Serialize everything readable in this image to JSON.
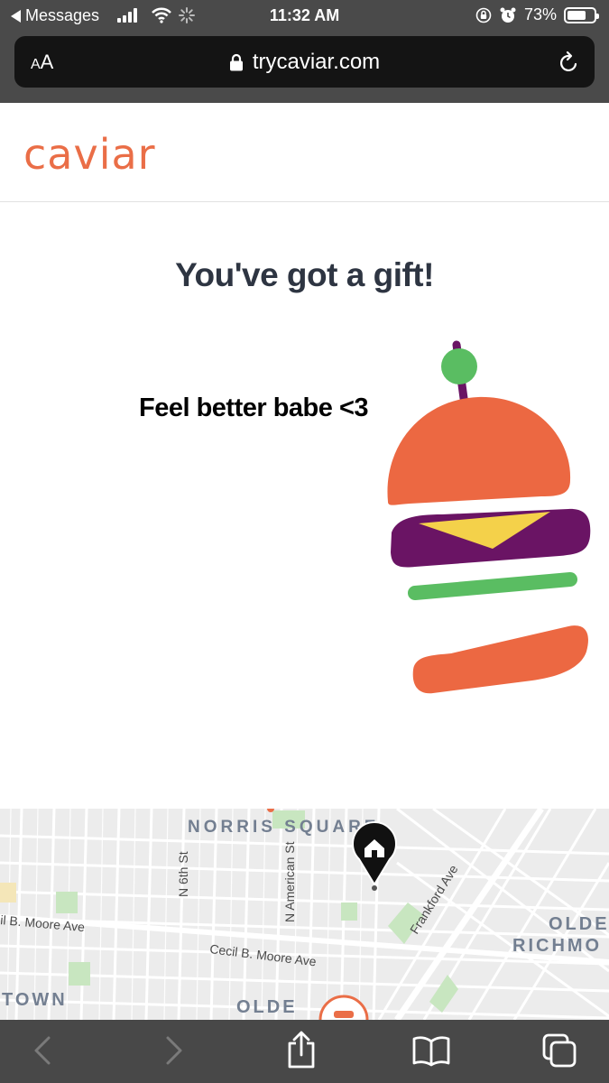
{
  "status_bar": {
    "back_app": "Messages",
    "time": "11:32 AM",
    "battery": "73%",
    "battery_level": 0.73
  },
  "browser": {
    "text_size_label_small": "A",
    "text_size_label_large": "A",
    "url": "trycaviar.com"
  },
  "site": {
    "logo": "caviar",
    "title": "You've got a gift!",
    "gift_message": "Feel better babe <3"
  },
  "map": {
    "labels": {
      "norris_square": "NORRIS SQUARE",
      "n_6th_st": "N 6th St",
      "n_american_st": "N American St",
      "frankford_ave": "Frankford Ave",
      "moore_ave_left": "il B. Moore Ave",
      "cecil_moore_ave": "Cecil B. Moore Ave",
      "olde_richmond_1": "OLDE",
      "olde_richmond_2": "RICHMO",
      "town": "TOWN",
      "olde": "OLDE"
    }
  },
  "colors": {
    "brand": "#ea6e47",
    "title_text": "#2e3542",
    "bun": "#ec6842",
    "patty": "#6a1464",
    "cheese": "#f4d14a",
    "lettuce": "#5abd62",
    "olive": "#5abd62"
  }
}
